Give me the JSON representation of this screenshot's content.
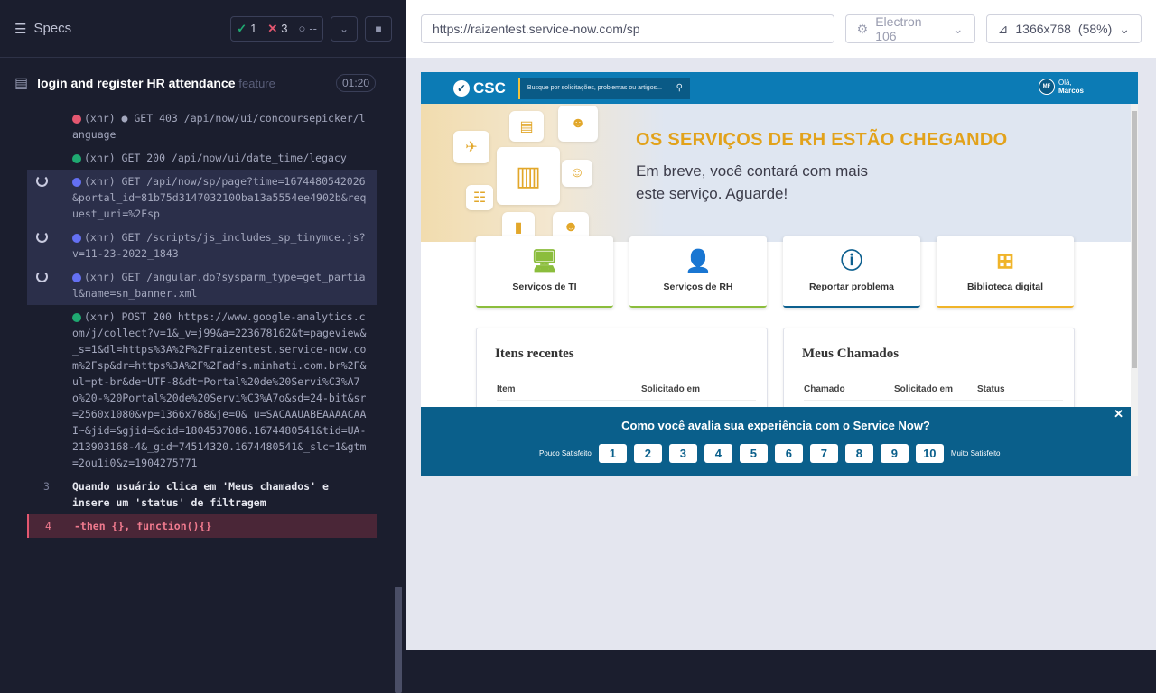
{
  "runner": {
    "title": "Specs",
    "passed": "1",
    "failed": "3",
    "pending": "--",
    "spec_name": "login and register HR attendance",
    "spec_tag": "feature",
    "duration": "01:20"
  },
  "log": [
    {
      "text": "(xhr)  ● GET 403 /api/now/ui/concoursepicker/language",
      "hl": false,
      "spin": false,
      "dot": "red"
    },
    {
      "text": "(xhr)  GET 200 /api/now/ui/date_time/legacy",
      "hl": false,
      "spin": false,
      "dot": "green"
    },
    {
      "text": "(xhr)  GET /api/now/sp/page?time=1674480542026&portal_id=81b75d3147032100ba13a5554ee4902b&request_uri=%2Fsp",
      "hl": true,
      "spin": true,
      "dot": "blue"
    },
    {
      "text": "(xhr)  GET /scripts/js_includes_sp_tinymce.js?v=11-23-2022_1843",
      "hl": true,
      "spin": true,
      "dot": "blue"
    },
    {
      "text": "(xhr)  GET /angular.do?sysparm_type=get_partial&name=sn_banner.xml",
      "hl": true,
      "spin": true,
      "dot": "blue"
    },
    {
      "text": "(xhr)  POST 200 https://www.google-analytics.com/j/collect?v=1&_v=j99&a=223678162&t=pageview&_s=1&dl=https%3A%2F%2Fraizentest.service-now.com%2Fsp&dr=https%3A%2F%2Fadfs.minhati.com.br%2F&ul=pt-br&de=UTF-8&dt=Portal%20de%20Servi%C3%A7o%20-%20Portal%20de%20Servi%C3%A7o&sd=24-bit&sr=2560x1080&vp=1366x768&je=0&_u=SACAAUABEAAAACAAI~&jid=&gjid=&cid=1804537086.1674480541&tid=UA-213903168-4&_gid=74514320.1674480541&_slc=1&gtm=2ou1i0&z=1904275771",
      "hl": false,
      "spin": false,
      "dot": "green"
    }
  ],
  "steps": [
    {
      "num": "3",
      "text": "Quando  usuário clica em 'Meus chamados' e insere um 'status' de filtragem",
      "err": false
    },
    {
      "num": "4",
      "text": "-then  {}, function(){}",
      "err": true
    }
  ],
  "browser": {
    "url": "https://raizentest.service-now.com/sp",
    "browser_name": "Electron 106",
    "viewport": "1366x768",
    "zoom": "(58%)"
  },
  "portal": {
    "logo": "CSC",
    "search_placeholder": "Busque por solicitações, problemas ou artigos...",
    "user_initials": "MF",
    "greeting": "Olá,",
    "user_name": "Marcos",
    "banner_title": "OS SERVIÇOS DE RH ESTÃO CHEGANDO",
    "banner_line1": "Em breve, você contará com mais",
    "banner_line2": "este serviço. Aguarde!",
    "cards": [
      {
        "label": "Serviços de TI",
        "icon": "🖥",
        "color": "#8bbd3c"
      },
      {
        "label": "Serviços de RH",
        "icon": "👤",
        "color": "#8bbd3c"
      },
      {
        "label": "Reportar problema",
        "icon": "ⓘ",
        "color": "#0c5f8e"
      },
      {
        "label": "Biblioteca digital",
        "icon": "⊞",
        "color": "#f0b429"
      }
    ],
    "recent": {
      "title": "Itens recentes",
      "col1": "Item",
      "col2": "Solicitado em"
    },
    "tickets": {
      "title": "Meus Chamados",
      "col1": "Chamado",
      "col2": "Solicitado em",
      "col3": "Status"
    },
    "survey": {
      "question": "Como você avalia sua experiência com o Service Now?",
      "low": "Pouco Satisfeito",
      "high": "Muito Satisfeito",
      "options": [
        "1",
        "2",
        "3",
        "4",
        "5",
        "6",
        "7",
        "8",
        "9",
        "10"
      ]
    }
  }
}
